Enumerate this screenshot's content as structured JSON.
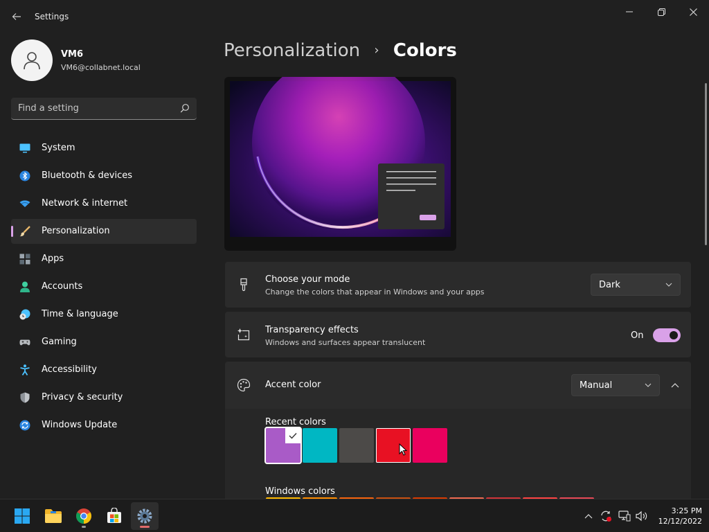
{
  "window": {
    "title": "Settings"
  },
  "user": {
    "name": "VM6",
    "email": "VM6@collabnet.local"
  },
  "search": {
    "placeholder": "Find a setting"
  },
  "nav": [
    {
      "label": "System",
      "icon": "monitor-icon"
    },
    {
      "label": "Bluetooth & devices",
      "icon": "bluetooth-icon"
    },
    {
      "label": "Network & internet",
      "icon": "wifi-icon"
    },
    {
      "label": "Personalization",
      "icon": "brush-icon",
      "active": true
    },
    {
      "label": "Apps",
      "icon": "apps-icon"
    },
    {
      "label": "Accounts",
      "icon": "person-icon"
    },
    {
      "label": "Time & language",
      "icon": "clock-globe-icon"
    },
    {
      "label": "Gaming",
      "icon": "gamepad-icon"
    },
    {
      "label": "Accessibility",
      "icon": "accessibility-icon"
    },
    {
      "label": "Privacy & security",
      "icon": "shield-icon"
    },
    {
      "label": "Windows Update",
      "icon": "update-icon"
    }
  ],
  "breadcrumb": {
    "parent": "Personalization",
    "current": "Colors"
  },
  "mode": {
    "title": "Choose your mode",
    "description": "Change the colors that appear in Windows and your apps",
    "value": "Dark"
  },
  "transparency": {
    "title": "Transparency effects",
    "description": "Windows and surfaces appear translucent",
    "state_label": "On",
    "on": true
  },
  "accent": {
    "title": "Accent color",
    "value": "Manual"
  },
  "recent_colors": {
    "label": "Recent colors",
    "colors": [
      "#a95bc7",
      "#00b7c3",
      "#4c4a48",
      "#e81123",
      "#ea005e"
    ],
    "selected_index": 0
  },
  "windows_colors": {
    "label": "Windows colors",
    "colors": [
      "#ffb900",
      "#ff8c00",
      "#f7630c",
      "#ca5010",
      "#da3b01",
      "#ef6950",
      "#d13438",
      "#ff4343",
      "#e74856"
    ]
  },
  "taskbar": {
    "apps": [
      "windows-start-icon",
      "file-explorer-icon",
      "chrome-icon",
      "microsoft-store-icon",
      "settings-icon"
    ],
    "time": "3:25 PM",
    "date": "12/12/2022"
  },
  "colors": {
    "accent": "#d9a1e8",
    "background": "#202020",
    "card": "#2b2b2b"
  }
}
